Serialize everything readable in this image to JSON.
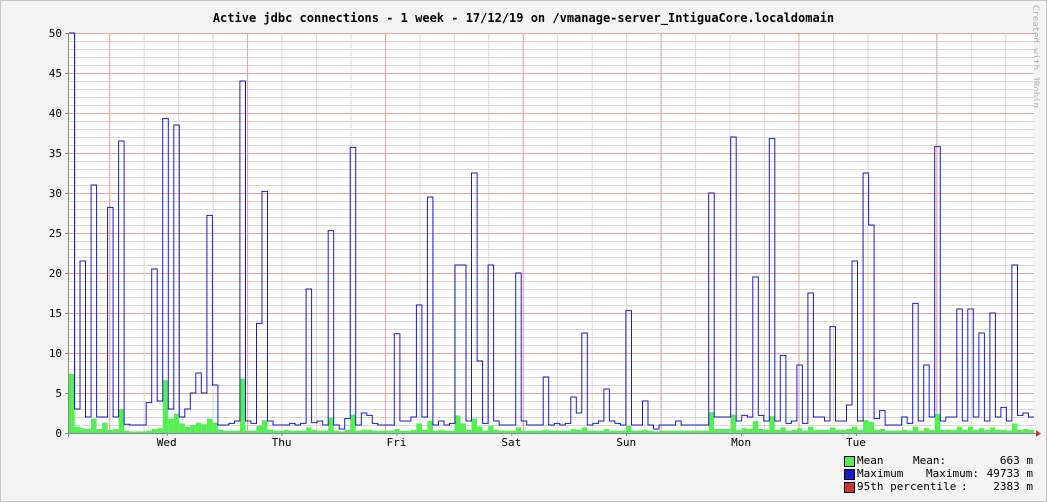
{
  "title": "Active jdbc connections - 1 week - 17/12/19 on /vmanage-server_IntiguaCore.localdomain",
  "watermark": "Created with JRobin",
  "colors": {
    "background": "#f4f4f4",
    "canvas": "#ffffff",
    "grid_minor": "#d8d8d8",
    "grid_major": "#e8a0a0",
    "mean": "#55ee55",
    "maximum": "#1a1acc",
    "percentile": "#cc3333",
    "axis": "#888888"
  },
  "legend": [
    {
      "swatch_color": "#55ee55",
      "label": "Mean",
      "stat_label": "Mean:",
      "value": "663 m",
      "icon": "green-square"
    },
    {
      "swatch_color": "#1a1acc",
      "label": "Maximum",
      "stat_label": "Maximum:",
      "value": "49733 m",
      "icon": "blue-square"
    },
    {
      "swatch_color": "#cc3333",
      "label": "95th percentile",
      "stat_label": ":",
      "value": "2383 m",
      "icon": "red-square"
    }
  ],
  "chart_data": {
    "type": "area",
    "title": "Active jdbc connections - 1 week - 17/12/19 on /vmanage-server_IntiguaCore.localdomain",
    "xlabel": "",
    "ylabel": "",
    "ylim": [
      0,
      50
    ],
    "yticks": [
      0,
      5,
      10,
      15,
      20,
      25,
      30,
      35,
      40,
      45,
      50
    ],
    "xlim": [
      0,
      168
    ],
    "xticks": [
      {
        "x": 17,
        "label": "Wed"
      },
      {
        "x": 37,
        "label": "Thu"
      },
      {
        "x": 57,
        "label": "Fri"
      },
      {
        "x": 77,
        "label": "Sat"
      },
      {
        "x": 97,
        "label": "Sun"
      },
      {
        "x": 117,
        "label": "Mon"
      },
      {
        "x": 137,
        "label": "Tue"
      }
    ],
    "grid": true,
    "legend_position": "bottom-right",
    "series": [
      {
        "name": "Maximum",
        "style": "step-line",
        "values": [
          50,
          3,
          21.5,
          2,
          31,
          2,
          2,
          28.2,
          2,
          36.5,
          1.1,
          1,
          1,
          1,
          3.8,
          20.5,
          4,
          39.3,
          3,
          38.5,
          2,
          3,
          5,
          7.5,
          5,
          27.2,
          6,
          1,
          1,
          1.2,
          1.5,
          44,
          1.5,
          1.2,
          13.7,
          30.2,
          1.5,
          1,
          1,
          1,
          1.2,
          1,
          1.2,
          18,
          1.3,
          1.5,
          1,
          25.3,
          1,
          0.5,
          1.8,
          35.7,
          1,
          2.5,
          2.2,
          1.2,
          1,
          1,
          1,
          12.4,
          1.5,
          1.5,
          2,
          16,
          2,
          29.5,
          1,
          1.5,
          1,
          1.2,
          21,
          21,
          1.5,
          32.5,
          9,
          1.2,
          21,
          1.5,
          1,
          1,
          1,
          20,
          1.5,
          1,
          1,
          1,
          7,
          1,
          1.2,
          1,
          1.2,
          4.5,
          2.5,
          12.5,
          1,
          1.2,
          1.5,
          5.5,
          1.5,
          1.2,
          1,
          15.3,
          1,
          1,
          4,
          1,
          0.5,
          1,
          1,
          1,
          1.5,
          1,
          1,
          1,
          1,
          1,
          30,
          2,
          2,
          2,
          37,
          1.5,
          2.2,
          2,
          19.5,
          2.2,
          1.5,
          36.8,
          1.5,
          9.7,
          1.2,
          1.5,
          8.5,
          1.2,
          17.5,
          2,
          2,
          1.5,
          13.3,
          1.5,
          1.5,
          3.5,
          21.5,
          1.5,
          32.5,
          26,
          1.8,
          2.8,
          1,
          1,
          1,
          2,
          1.2,
          16.2,
          1.5,
          8.5,
          2,
          35.8,
          1.5,
          2,
          2,
          15.5,
          1.5,
          15.5,
          2,
          12.5,
          1.5,
          15,
          2,
          3.2,
          1.5,
          21,
          2.2,
          2.5,
          2
        ]
      },
      {
        "name": "Mean",
        "style": "bars",
        "values": [
          7.4,
          0.8,
          0.6,
          0.5,
          1.8,
          0.5,
          1.3,
          0.4,
          0.5,
          3,
          0.3,
          0.2,
          0.2,
          0.2,
          0.3,
          0.5,
          0.6,
          6.6,
          1.8,
          2.4,
          1.2,
          0.8,
          1,
          1.3,
          1.1,
          1.8,
          1.3,
          0.4,
          0.3,
          0.3,
          0.3,
          6.8,
          0.3,
          0.3,
          0.9,
          1.6,
          0.4,
          0.3,
          0.3,
          0.4,
          0.3,
          0.3,
          0.3,
          0.7,
          0.4,
          0.3,
          0.3,
          1.9,
          0.3,
          0.2,
          0.4,
          2.3,
          0.3,
          0.4,
          0.4,
          0.3,
          0.3,
          0.3,
          0.3,
          0.5,
          0.3,
          0.3,
          0.4,
          1.2,
          0.4,
          1.5,
          0.3,
          0.4,
          0.3,
          0.3,
          2.2,
          1.2,
          0.4,
          1.8,
          0.8,
          0.3,
          0.9,
          0.4,
          0.3,
          0.3,
          0.3,
          0.7,
          0.3,
          0.3,
          0.3,
          0.3,
          0.4,
          0.3,
          0.3,
          0.3,
          0.3,
          0.5,
          0.4,
          0.7,
          0.3,
          0.3,
          0.3,
          0.5,
          0.3,
          0.3,
          0.3,
          0.9,
          0.3,
          0.3,
          0.4,
          0.3,
          0.2,
          0.3,
          0.3,
          0.3,
          0.3,
          0.3,
          0.3,
          0.3,
          0.3,
          0.3,
          2.6,
          0.5,
          0.5,
          0.5,
          2.3,
          0.4,
          0.6,
          0.5,
          1.5,
          0.5,
          0.4,
          2.1,
          0.4,
          0.7,
          0.3,
          0.4,
          0.6,
          0.3,
          0.8,
          0.4,
          0.4,
          0.4,
          0.7,
          0.4,
          0.4,
          0.5,
          0.8,
          0.4,
          1.6,
          1.4,
          0.4,
          0.5,
          0.3,
          0.3,
          0.3,
          0.4,
          0.3,
          0.8,
          0.3,
          0.6,
          0.4,
          2.4,
          0.4,
          0.4,
          0.4,
          0.8,
          0.4,
          0.8,
          0.4,
          0.6,
          0.4,
          0.7,
          0.4,
          0.4,
          0.3,
          1.2,
          0.4,
          0.5,
          0.4
        ]
      }
    ]
  }
}
